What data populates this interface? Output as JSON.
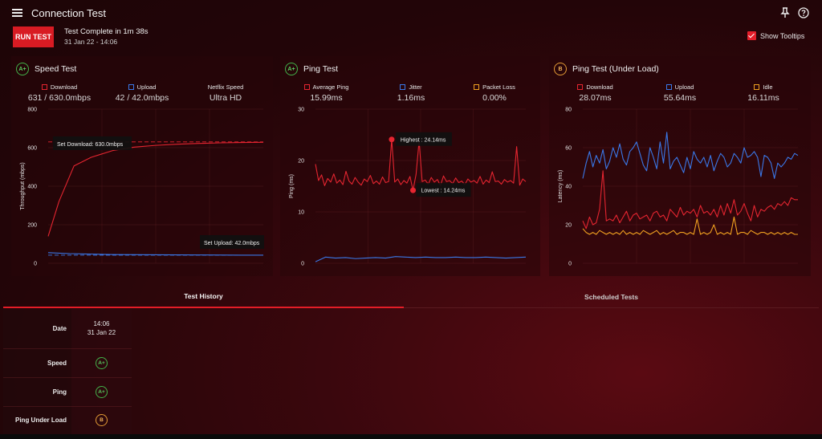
{
  "app": {
    "title": "Connection Test"
  },
  "icons": {
    "menu": "hamburger-icon",
    "pin": "pin-icon",
    "help": "help-icon"
  },
  "colors": {
    "accent": "#e31d27",
    "download": "#e52530",
    "upload": "#3a78e8",
    "amber": "#f0a020",
    "grade_a": "#43b34a",
    "grade_b": "#e39b35"
  },
  "toolbar": {
    "run_label": "RUN TEST",
    "status": "Test Complete in 1m 38s",
    "timestamp": "31 Jan 22 - 14:06",
    "tooltips_label": "Show Tooltips",
    "tooltips_checked": true
  },
  "panels": [
    {
      "title": "Speed Test",
      "grade": "A+",
      "stats": [
        {
          "label": "Download",
          "value": "631 / 630.0mbps",
          "color": "#e52530"
        },
        {
          "label": "Upload",
          "value": "42 / 42.0mbps",
          "color": "#3a78e8"
        },
        {
          "label": "Netflix Speed",
          "value": "Ultra HD"
        }
      ]
    },
    {
      "title": "Ping Test",
      "grade": "A+",
      "stats": [
        {
          "label": "Average Ping",
          "value": "15.99ms",
          "color": "#e52530"
        },
        {
          "label": "Jitter",
          "value": "1.16ms",
          "color": "#3a78e8"
        },
        {
          "label": "Packet Loss",
          "value": "0.00%",
          "color": "#f0a020"
        }
      ]
    },
    {
      "title": "Ping Test (Under Load)",
      "grade": "B",
      "stats": [
        {
          "label": "Download",
          "value": "28.07ms",
          "color": "#e52530"
        },
        {
          "label": "Upload",
          "value": "55.64ms",
          "color": "#3a78e8"
        },
        {
          "label": "Idle",
          "value": "16.11ms",
          "color": "#f0a020"
        }
      ]
    }
  ],
  "chart_data": [
    {
      "type": "line",
      "ylabel": "Throughput (mbps)",
      "ylim": [
        0,
        800
      ],
      "yticks": [
        0,
        200,
        400,
        600,
        800
      ],
      "annotations": [
        "Set Download: 630.0mbps",
        "Set Upload: 42.0mbps"
      ],
      "reference_lines": [
        630,
        42
      ],
      "series": [
        {
          "name": "Download",
          "color": "#e52530",
          "x": [
            0,
            0.05,
            0.12,
            0.2,
            0.3,
            0.4,
            0.5,
            0.6,
            0.7,
            0.8,
            0.9,
            1.0
          ],
          "y": [
            140,
            320,
            505,
            550,
            585,
            603,
            612,
            618,
            622,
            625,
            627,
            628
          ]
        },
        {
          "name": "Upload",
          "color": "#3a78e8",
          "x": [
            0,
            0.1,
            0.3,
            0.5,
            0.7,
            0.9,
            1.0
          ],
          "y": [
            55,
            50,
            45,
            44,
            43,
            42,
            42
          ]
        }
      ]
    },
    {
      "type": "line",
      "ylabel": "Ping (ms)",
      "ylim": [
        0,
        30
      ],
      "yticks": [
        0,
        10,
        20,
        30
      ],
      "annotations": [
        "Highest : 24.14ms",
        "Lowest : 14.24ms"
      ],
      "series": [
        {
          "name": "Average Ping",
          "color": "#e52530",
          "y": [
            19.3,
            16.1,
            17.2,
            15.1,
            16.5,
            15.8,
            17.4,
            15.6,
            16.2,
            15.3,
            17.9,
            16.0,
            15.4,
            16.7,
            15.8,
            15.2,
            16.4,
            15.9,
            17.1,
            15.5,
            16.0,
            15.4,
            16.8,
            15.7,
            15.9,
            24.1,
            15.8,
            16.4,
            15.3,
            16.1,
            15.6,
            16.9,
            14.2,
            17.3,
            23.8,
            15.9,
            16.2,
            15.4,
            16.7,
            15.8,
            16.3,
            15.1,
            17.0,
            15.9,
            16.1,
            15.5,
            16.6,
            15.7,
            16.0,
            15.3,
            16.4,
            15.8,
            16.1,
            15.6,
            16.9,
            15.4,
            16.2,
            15.7,
            17.8,
            15.9,
            16.0,
            15.4,
            16.3,
            15.8,
            16.1,
            15.6,
            22.7,
            15.2,
            16.4,
            15.9
          ]
        },
        {
          "name": "Jitter",
          "color": "#3a78e8",
          "y": [
            0.3,
            1.2,
            1.0,
            1.1,
            0.9,
            1.0,
            1.1,
            1.0,
            1.3,
            1.2,
            1.1,
            1.2,
            1.1,
            1.1,
            1.2,
            1.1,
            1.1,
            1.2,
            1.1,
            1.0,
            1.1,
            1.2
          ]
        }
      ]
    },
    {
      "type": "line",
      "ylabel": "Latency (ms)",
      "ylim": [
        0,
        80
      ],
      "yticks": [
        0,
        20,
        40,
        60,
        80
      ],
      "series": [
        {
          "name": "Download",
          "color": "#e52530",
          "y": [
            22,
            18,
            24,
            20,
            21,
            28,
            48,
            22,
            23,
            22,
            25,
            21,
            24,
            27,
            22,
            25,
            26,
            23,
            24,
            25,
            22,
            26,
            27,
            24,
            25,
            22,
            28,
            26,
            24,
            29,
            25,
            27,
            26,
            28,
            24,
            30,
            26,
            27,
            25,
            28,
            24,
            30,
            25,
            31,
            26,
            33,
            25,
            27,
            31,
            26,
            22,
            30,
            24,
            28,
            27,
            29,
            30,
            28,
            31,
            30,
            32,
            30,
            34,
            33,
            33
          ]
        },
        {
          "name": "Upload",
          "color": "#3a78e8",
          "y": [
            44,
            52,
            58,
            50,
            56,
            52,
            59,
            49,
            53,
            60,
            55,
            62,
            54,
            51,
            58,
            60,
            63,
            57,
            51,
            48,
            60,
            55,
            49,
            63,
            52,
            68,
            49,
            53,
            55,
            51,
            47,
            55,
            49,
            58,
            54,
            52,
            55,
            50,
            56,
            48,
            53,
            57,
            55,
            50,
            52,
            57,
            55,
            52,
            60,
            55,
            56,
            58,
            55,
            45,
            56,
            55,
            52,
            44,
            52,
            50,
            52,
            55,
            54,
            57,
            56
          ]
        },
        {
          "name": "Idle",
          "color": "#f0a020",
          "y": [
            18,
            16,
            15,
            16,
            15,
            17,
            16,
            15,
            16,
            15,
            16,
            15,
            17,
            15,
            16,
            15,
            16,
            15,
            17,
            16,
            15,
            16,
            17,
            15,
            16,
            15,
            16,
            17,
            15,
            16,
            16,
            15,
            16,
            15,
            23,
            15,
            16,
            15,
            16,
            20,
            15,
            16,
            15,
            16,
            15,
            24,
            15,
            16,
            16,
            15,
            17,
            16,
            15,
            16,
            16,
            15,
            16,
            15,
            16,
            15,
            16,
            15,
            16,
            15,
            15
          ]
        }
      ]
    }
  ],
  "tabs": [
    {
      "label": "Test History"
    },
    {
      "label": "Scheduled Tests"
    }
  ],
  "history": {
    "row_labels": [
      "Date",
      "Speed",
      "Ping",
      "Ping Under Load"
    ],
    "entries": [
      {
        "time": "14:06",
        "date": "31 Jan 22",
        "speed": "A+",
        "ping": "A+",
        "ping_under_load": "B"
      }
    ]
  }
}
